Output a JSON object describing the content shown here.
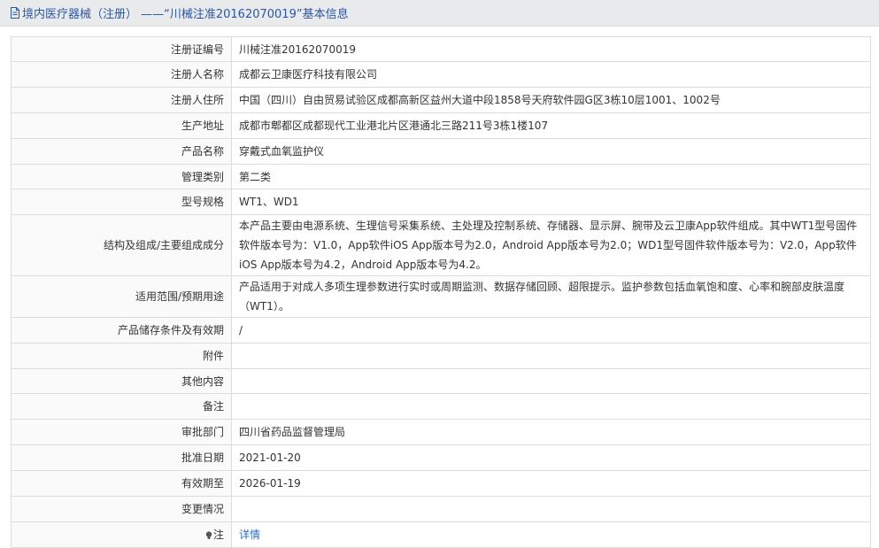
{
  "header": {
    "title": "境内医疗器械（注册） ——“川械注准20162070019”基本信息"
  },
  "rows": [
    {
      "label": "注册证编号",
      "value": "川械注准20162070019"
    },
    {
      "label": "注册人名称",
      "value": "成都云卫康医疗科技有限公司"
    },
    {
      "label": "注册人住所",
      "value": "中国（四川）自由贸易试验区成都高新区益州大道中段1858号天府软件园G区3栋10层1001、1002号"
    },
    {
      "label": "生产地址",
      "value": "成都市郫都区成都现代工业港北片区港通北三路211号3栋1楼107"
    },
    {
      "label": "产品名称",
      "value": "穿戴式血氧监护仪"
    },
    {
      "label": "管理类别",
      "value": "第二类"
    },
    {
      "label": "型号规格",
      "value": "WT1、WD1"
    },
    {
      "label": "结构及组成/主要组成成分",
      "value": "本产品主要由电源系统、生理信号采集系统、主处理及控制系统、存储器、显示屏、腕带及云卫康App软件组成。其中WT1型号固件软件版本号为：V1.0，App软件iOS App版本号为2.0，Android App版本号为2.0；WD1型号固件软件版本号为：V2.0，App软件iOS App版本号为4.2，Android App版本号为4.2。"
    },
    {
      "label": "适用范围/预期用途",
      "value": "产品适用于对成人多项生理参数进行实时或周期监测、数据存储回顾、超限提示。监护参数包括血氧饱和度、心率和腕部皮肤温度（WT1）。"
    },
    {
      "label": "产品储存条件及有效期",
      "value": "/"
    },
    {
      "label": "附件",
      "value": ""
    },
    {
      "label": "其他内容",
      "value": ""
    },
    {
      "label": "备注",
      "value": ""
    },
    {
      "label": "审批部门",
      "value": "四川省药品监督管理局"
    },
    {
      "label": "批准日期",
      "value": "2021-01-20"
    },
    {
      "label": "有效期至",
      "value": "2026-01-19"
    },
    {
      "label": "变更情况",
      "value": ""
    }
  ],
  "note": {
    "label": "注",
    "link_text": "详情"
  }
}
